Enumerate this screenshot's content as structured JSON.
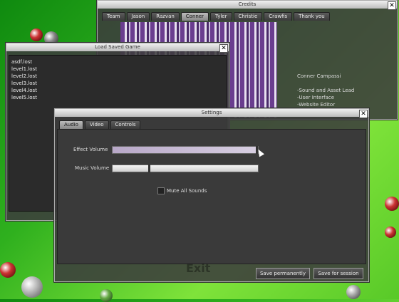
{
  "credits_window": {
    "title": "Credits",
    "tabs": [
      "Team",
      "Jason",
      "Razvan",
      "Conner",
      "Tyler",
      "Christie",
      "Crawfis",
      "Thank you"
    ],
    "active_tab": "Conner",
    "person_name": "Conner Campassi",
    "roles": [
      "-Sound and Asset Lead",
      "-User Interface",
      "-Website Editor"
    ]
  },
  "load_window": {
    "title": "Load Saved Game",
    "files": [
      "asdf.lost",
      "level1.lost",
      "level2.lost",
      "level3.lost",
      "level4.lost",
      "level5.lost"
    ]
  },
  "settings_window": {
    "title": "Settings",
    "tabs": [
      "Audio",
      "Video",
      "Controls"
    ],
    "active_tab": "Audio",
    "effect_volume_label": "Effect Volume",
    "effect_volume_level": 1.0,
    "music_volume_label": "Music Volume",
    "music_volume_level": 0.25,
    "mute_label": "Mute All Sounds",
    "mute_checked": false,
    "save_permanently_label": "Save permanently",
    "save_session_label": "Save for session"
  },
  "background_menu": {
    "exit_label": "Exit"
  },
  "colors": {
    "background_green": "#2fb01e",
    "slider_fill": "#c8bcd8"
  }
}
